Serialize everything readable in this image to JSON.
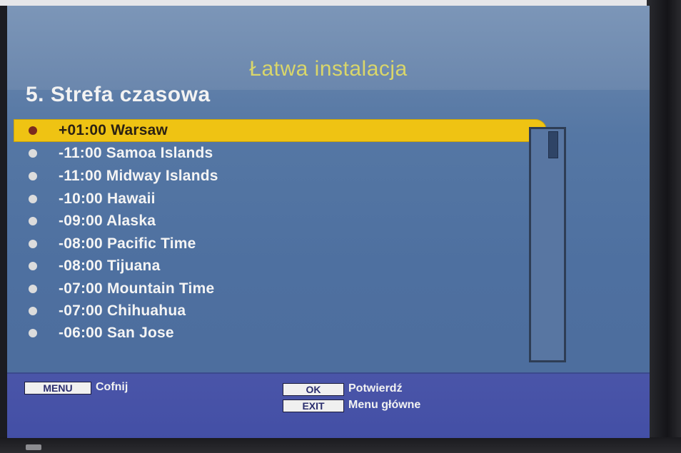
{
  "header": {
    "wizard_title": "Łatwa instalacja",
    "step_title": "5. Strefa czasowa"
  },
  "timezones": [
    {
      "label": "+01:00 Warsaw",
      "selected": true
    },
    {
      "label": "-11:00 Samoa Islands",
      "selected": false
    },
    {
      "label": "-11:00 Midway Islands",
      "selected": false
    },
    {
      "label": "-10:00 Hawaii",
      "selected": false
    },
    {
      "label": "-09:00 Alaska",
      "selected": false
    },
    {
      "label": "-08:00 Pacific Time",
      "selected": false
    },
    {
      "label": "-08:00 Tijuana",
      "selected": false
    },
    {
      "label": "-07:00 Mountain Time",
      "selected": false
    },
    {
      "label": "-07:00 Chihuahua",
      "selected": false
    },
    {
      "label": "-06:00 San Jose",
      "selected": false
    }
  ],
  "footer": {
    "menu_key": "MENU",
    "menu_label": "Cofnij",
    "ok_key": "OK",
    "ok_label": "Potwierdź",
    "exit_key": "EXIT",
    "exit_label": "Menu główne"
  },
  "colors": {
    "selection": "#efc313",
    "title_yellow": "#d9d66a",
    "screen_blue": "#5577a4",
    "footer_blue": "#434fa6"
  }
}
